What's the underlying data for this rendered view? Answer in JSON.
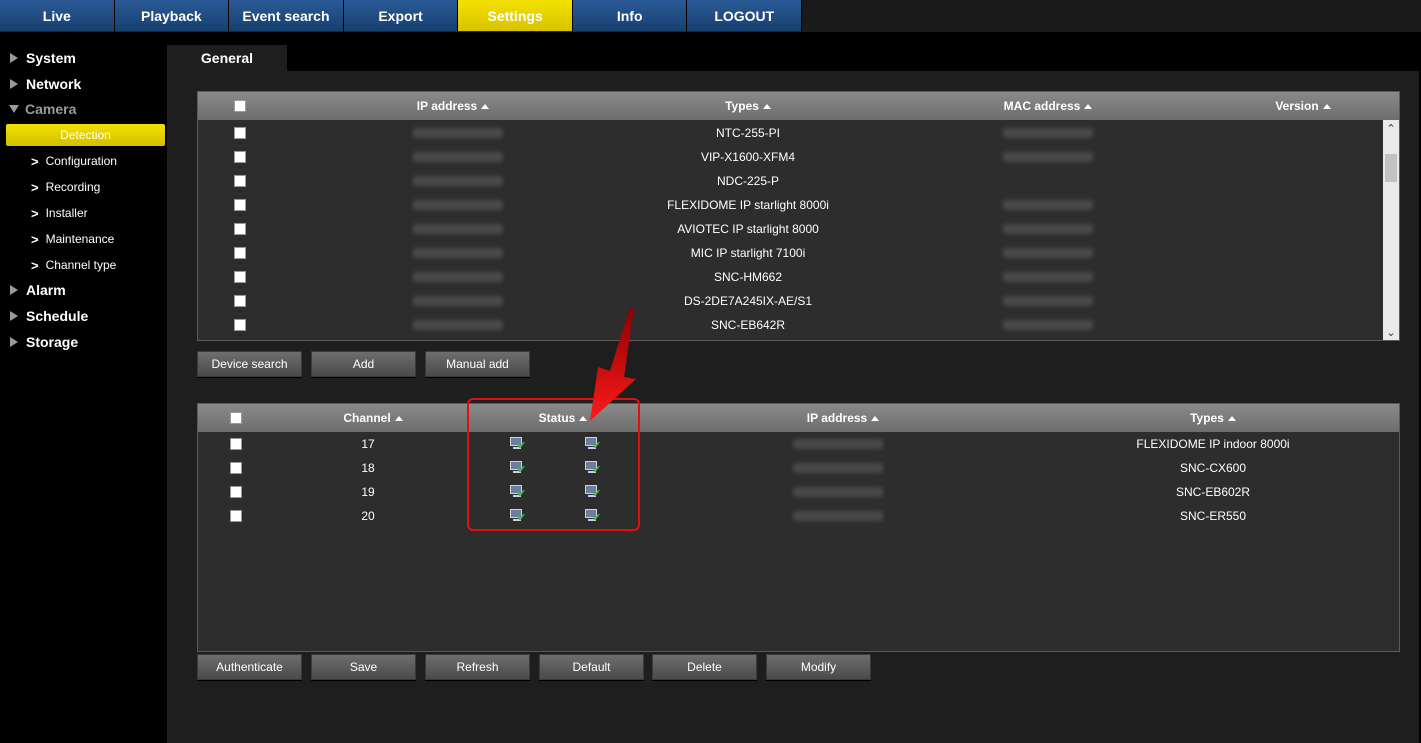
{
  "nav": {
    "tabs": [
      {
        "label": "Live"
      },
      {
        "label": "Playback"
      },
      {
        "label": "Event search"
      },
      {
        "label": "Export"
      },
      {
        "label": "Settings",
        "active": true
      },
      {
        "label": "Info"
      },
      {
        "label": "LOGOUT"
      }
    ]
  },
  "sidebar": {
    "system": "System",
    "network": "Network",
    "camera": "Camera",
    "detection": "Detection",
    "configuration": "Configuration",
    "recording": "Recording",
    "installer": "Installer",
    "maintenance": "Maintenance",
    "channel_type": "Channel type",
    "alarm": "Alarm",
    "schedule": "Schedule",
    "storage": "Storage"
  },
  "content": {
    "tab_general": "General"
  },
  "device_table": {
    "headers": {
      "ip": "IP address",
      "types": "Types",
      "mac": "MAC address",
      "version": "Version"
    },
    "rows": [
      {
        "type": "NTC-255-PI"
      },
      {
        "type": "VIP-X1600-XFM4"
      },
      {
        "type": "NDC-225-P"
      },
      {
        "type": "FLEXIDOME IP starlight 8000i"
      },
      {
        "type": "AVIOTEC IP starlight 8000"
      },
      {
        "type": "MIC IP starlight 7100i"
      },
      {
        "type": "SNC-HM662"
      },
      {
        "type": "DS-2DE7A245IX-AE/S1"
      },
      {
        "type": "SNC-EB642R"
      }
    ]
  },
  "device_buttons": {
    "device_search": "Device search",
    "add": "Add",
    "manual_add": "Manual add"
  },
  "channel_table": {
    "headers": {
      "channel": "Channel",
      "status": "Status",
      "ip": "IP address",
      "types": "Types"
    },
    "rows": [
      {
        "channel": "17",
        "type": "FLEXIDOME IP indoor 8000i"
      },
      {
        "channel": "18",
        "type": "SNC-CX600"
      },
      {
        "channel": "19",
        "type": "SNC-EB602R"
      },
      {
        "channel": "20",
        "type": "SNC-ER550"
      }
    ]
  },
  "channel_buttons": {
    "authenticate": "Authenticate",
    "save": "Save",
    "refresh": "Refresh",
    "default": "Default",
    "delete": "Delete",
    "modify": "Modify"
  },
  "colors": {
    "nav_blue": "#1f4d85",
    "accent_yellow": "#e8d400",
    "highlight_red": "#e01010"
  }
}
